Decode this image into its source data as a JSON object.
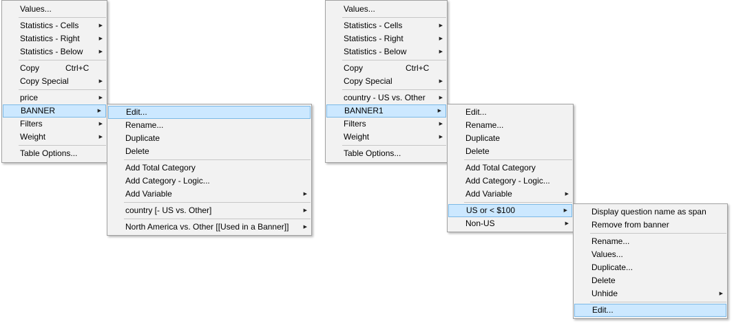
{
  "left": {
    "main_menu": {
      "values": "Values...",
      "stats_cells": "Statistics - Cells",
      "stats_right": "Statistics - Right",
      "stats_below": "Statistics - Below",
      "copy": "Copy",
      "copy_shortcut": "Ctrl+C",
      "copy_special": "Copy Special",
      "price": "price",
      "banner": "BANNER",
      "filters": "Filters",
      "weight": "Weight",
      "table_options": "Table Options..."
    },
    "banner_submenu": {
      "edit": "Edit...",
      "rename": "Rename...",
      "duplicate": "Duplicate",
      "delete": "Delete",
      "add_total": "Add Total Category",
      "add_logic": "Add Category - Logic...",
      "add_variable": "Add Variable",
      "country": "country [- US vs. Other]",
      "north_america": "North America vs. Other [[Used in a Banner]]"
    }
  },
  "right": {
    "main_menu": {
      "values": "Values...",
      "stats_cells": "Statistics - Cells",
      "stats_right": "Statistics - Right",
      "stats_below": "Statistics - Below",
      "copy": "Copy",
      "copy_shortcut": "Ctrl+C",
      "copy_special": "Copy Special",
      "country": "country - US vs. Other",
      "banner": "BANNER1",
      "filters": "Filters",
      "weight": "Weight",
      "table_options": "Table Options..."
    },
    "banner_submenu": {
      "edit": "Edit...",
      "rename": "Rename...",
      "duplicate": "Duplicate",
      "delete": "Delete",
      "add_total": "Add Total Category",
      "add_logic": "Add Category - Logic...",
      "add_variable": "Add Variable",
      "us_or": "US or < $100",
      "non_us": "Non-US"
    },
    "category_submenu": {
      "display_span": "Display question name as span",
      "remove": "Remove from banner",
      "rename": "Rename...",
      "values": "Values...",
      "duplicate": "Duplicate...",
      "delete": "Delete",
      "unhide": "Unhide",
      "edit": "Edit..."
    }
  },
  "arrow_glyph": "▶"
}
